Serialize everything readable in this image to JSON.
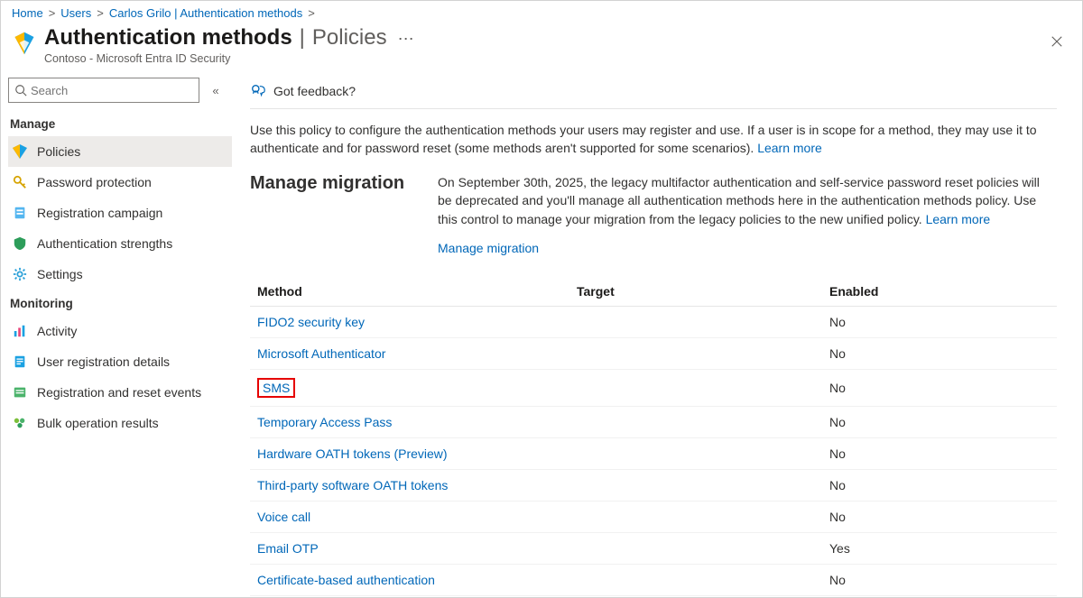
{
  "breadcrumb": {
    "home": "Home",
    "users": "Users",
    "user": "Carlos Grilo | Authentication methods"
  },
  "header": {
    "title": "Authentication methods",
    "subtitle_page": "Policies",
    "org_line": "Contoso - Microsoft Entra ID Security"
  },
  "search": {
    "placeholder": "Search"
  },
  "sidebar": {
    "sections": {
      "manage": "Manage",
      "monitoring": "Monitoring"
    },
    "manage_items": [
      {
        "label": "Policies"
      },
      {
        "label": "Password protection"
      },
      {
        "label": "Registration campaign"
      },
      {
        "label": "Authentication strengths"
      },
      {
        "label": "Settings"
      }
    ],
    "monitoring_items": [
      {
        "label": "Activity"
      },
      {
        "label": "User registration details"
      },
      {
        "label": "Registration and reset events"
      },
      {
        "label": "Bulk operation results"
      }
    ]
  },
  "toolbar": {
    "feedback": "Got feedback?"
  },
  "intro": {
    "text": "Use this policy to configure the authentication methods your users may register and use. If a user is in scope for a method, they may use it to authenticate and for password reset (some methods aren't supported for some scenarios).",
    "learn_more": "Learn more"
  },
  "migration": {
    "title": "Manage migration",
    "text": "On September 30th, 2025, the legacy multifactor authentication and self-service password reset policies will be deprecated and you'll manage all authentication methods here in the authentication methods policy. Use this control to manage your migration from the legacy policies to the new unified policy.",
    "learn_more": "Learn more",
    "action": "Manage migration"
  },
  "table": {
    "headers": {
      "method": "Method",
      "target": "Target",
      "enabled": "Enabled"
    },
    "rows": [
      {
        "method": "FIDO2 security key",
        "target": "",
        "enabled": "No",
        "highlight": false
      },
      {
        "method": "Microsoft Authenticator",
        "target": "",
        "enabled": "No",
        "highlight": false
      },
      {
        "method": "SMS",
        "target": "",
        "enabled": "No",
        "highlight": true
      },
      {
        "method": "Temporary Access Pass",
        "target": "",
        "enabled": "No",
        "highlight": false
      },
      {
        "method": "Hardware OATH tokens (Preview)",
        "target": "",
        "enabled": "No",
        "highlight": false
      },
      {
        "method": "Third-party software OATH tokens",
        "target": "",
        "enabled": "No",
        "highlight": false
      },
      {
        "method": "Voice call",
        "target": "",
        "enabled": "No",
        "highlight": false
      },
      {
        "method": "Email OTP",
        "target": "",
        "enabled": "Yes",
        "highlight": false
      },
      {
        "method": "Certificate-based authentication",
        "target": "",
        "enabled": "No",
        "highlight": false
      }
    ]
  }
}
